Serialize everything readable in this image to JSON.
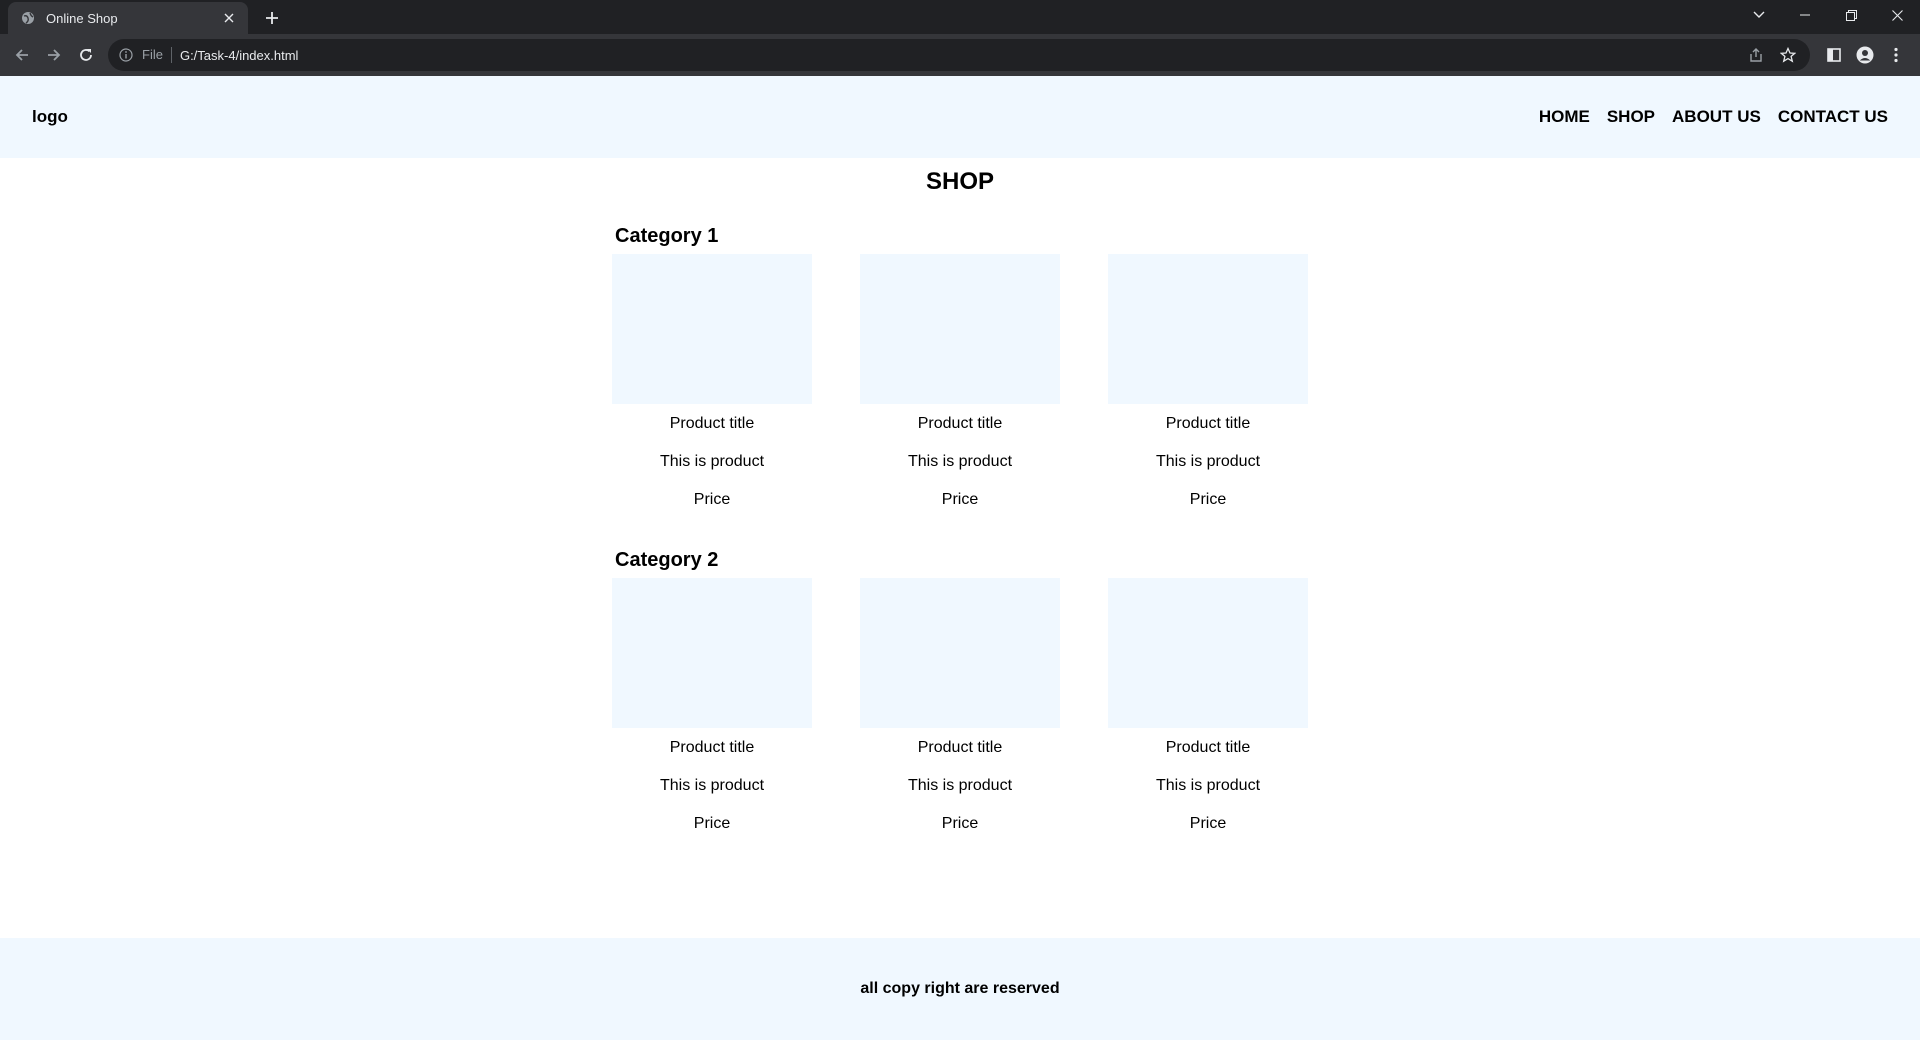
{
  "browser": {
    "tab_title": "Online Shop",
    "scheme_label": "File",
    "url": "G:/Task-4/index.html"
  },
  "header": {
    "logo": "logo",
    "nav": [
      "HOME",
      "SHOP",
      "ABOUT US",
      "CONTACT US"
    ]
  },
  "main": {
    "title": "SHOP",
    "categories": [
      {
        "name": "Category 1",
        "products": [
          {
            "title": "Product title",
            "description": "This is product",
            "price": "Price"
          },
          {
            "title": "Product title",
            "description": "This is product",
            "price": "Price"
          },
          {
            "title": "Product title",
            "description": "This is product",
            "price": "Price"
          }
        ]
      },
      {
        "name": "Category 2",
        "products": [
          {
            "title": "Product title",
            "description": "This is product",
            "price": "Price"
          },
          {
            "title": "Product title",
            "description": "This is product",
            "price": "Price"
          },
          {
            "title": "Product title",
            "description": "This is product",
            "price": "Price"
          }
        ]
      }
    ]
  },
  "footer": {
    "text": "all copy right are reserved"
  },
  "colors": {
    "accent_background": "#f0f8ff",
    "browser_dark": "#202124",
    "browser_toolbar": "#35363a"
  }
}
